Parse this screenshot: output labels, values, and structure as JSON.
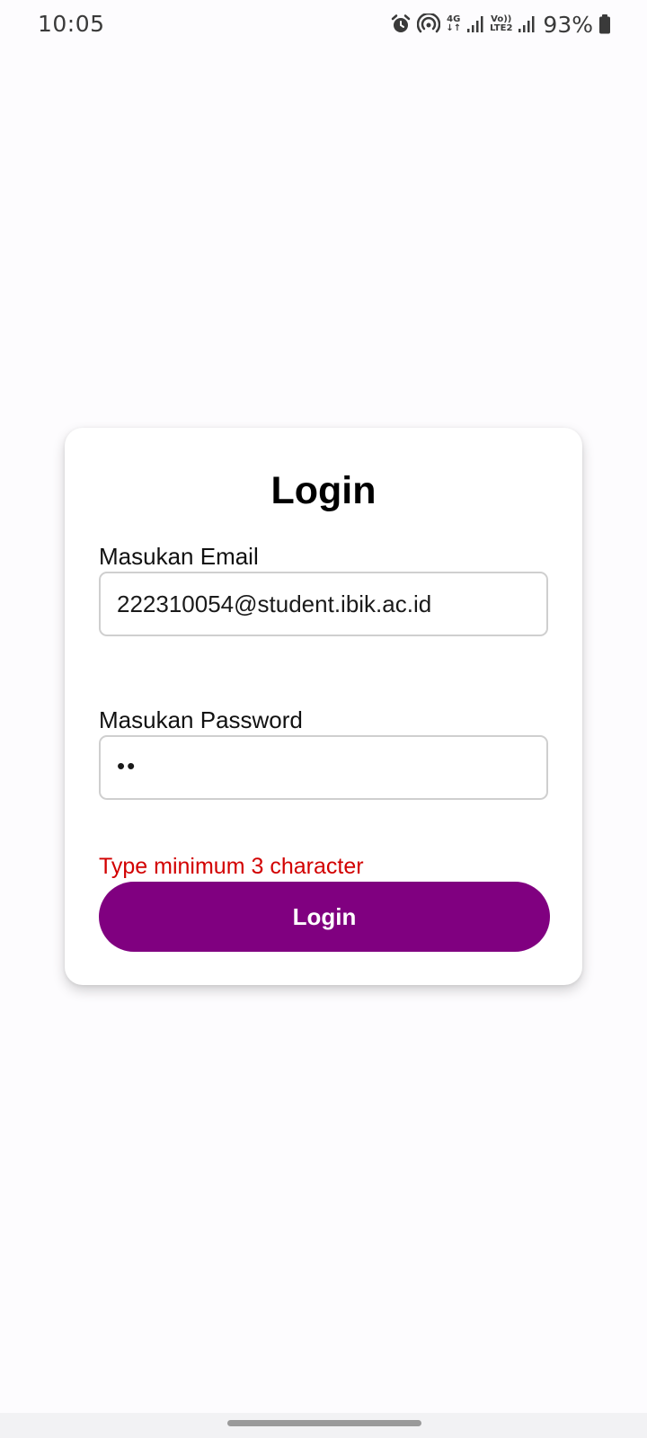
{
  "status_bar": {
    "time": "10:05",
    "network_4g": "4G",
    "network_volte_top": "Vo))",
    "network_volte_bottom": "LTE2",
    "battery_percent": "93%",
    "icons": [
      "alarm-icon",
      "hotspot-icon",
      "signal-icon",
      "signal-icon",
      "battery-icon"
    ]
  },
  "login_card": {
    "title": "Login",
    "email": {
      "label": "Masukan Email",
      "value": "222310054@student.ibik.ac.id"
    },
    "password": {
      "label": "Masukan Password",
      "masked_value": "••"
    },
    "error_message": "Type minimum 3 character",
    "submit_label": "Login"
  },
  "colors": {
    "button": "#800080",
    "error": "#d20000",
    "background": "#fdfcfe"
  }
}
